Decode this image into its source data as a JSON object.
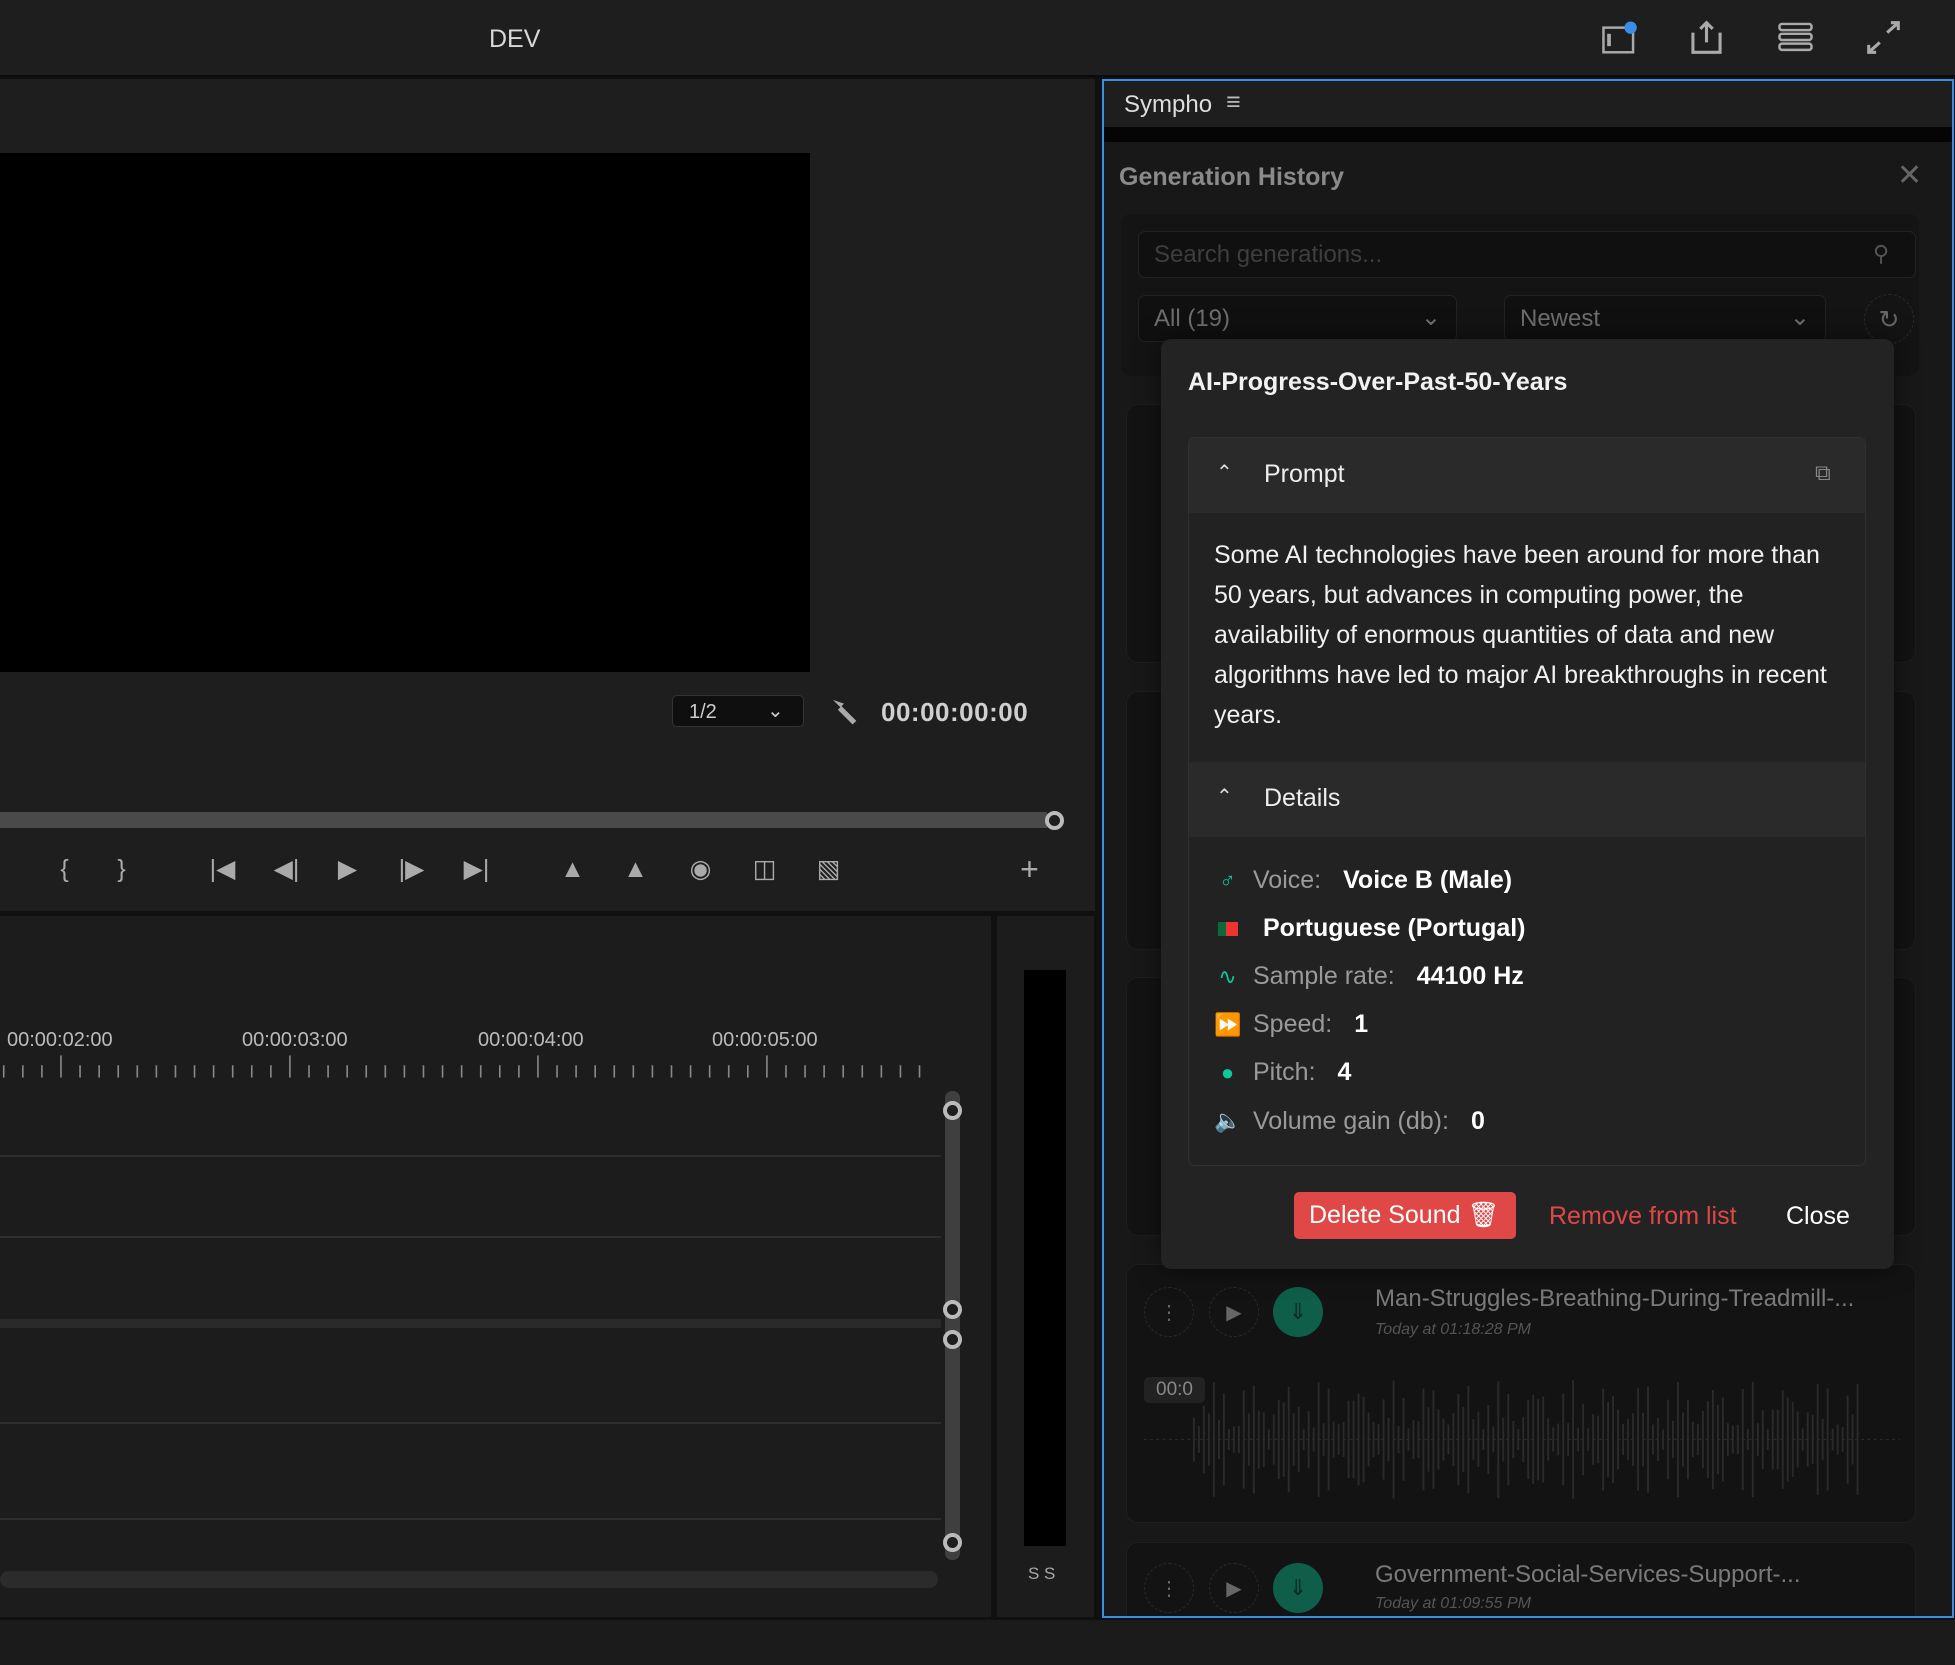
{
  "app": {
    "title": "DEV",
    "top_icons": [
      "panel-notification-icon",
      "share-icon",
      "menu-lines-icon",
      "fullscreen-icon"
    ]
  },
  "monitor": {
    "resolution": "1/2",
    "timecode": "00:00:00:00",
    "controls": [
      "mark-in-icon",
      "mark-out-icon",
      "go-to-in-icon",
      "step-back-icon",
      "play-icon",
      "step-forward-icon",
      "go-to-out-icon",
      "insert-icon",
      "overwrite-icon",
      "camera-icon",
      "compare-icon",
      "toggle-icon",
      "add-icon"
    ]
  },
  "timeline": {
    "ruler": [
      "00:00:02:00",
      "00:00:03:00",
      "00:00:04:00",
      "00:00:05:00"
    ],
    "meter_labels": "S S"
  },
  "panel": {
    "name": "Sympho",
    "history_title": "Generation History",
    "search_placeholder": "Search generations...",
    "filter": "All (19)",
    "sort": "Newest",
    "items": [
      {
        "title": "Man-Struggles-Breathing-During-Treadmill-...",
        "date": "Today at 01:18:28 PM",
        "time": "00:0"
      },
      {
        "title": "Government-Social-Services-Support-...",
        "date": "Today at 01:09:55 PM"
      }
    ]
  },
  "modal": {
    "title": "AI-Progress-Over-Past-50-Years",
    "prompt_label": "Prompt",
    "prompt_text": "Some AI technologies have been around for more than 50 years, but advances in computing power, the availability of enormous quantities of data and new algorithms have led to major AI breakthroughs in recent years.",
    "details_label": "Details",
    "details": [
      {
        "icon": "male-icon",
        "label": "Voice:",
        "value": "Voice B (Male)"
      },
      {
        "icon": "flag-portugal-icon",
        "label": "",
        "value": "Portuguese (Portugal)"
      },
      {
        "icon": "pulse-icon",
        "label": "Sample rate:",
        "value": "44100 Hz"
      },
      {
        "icon": "fast-forward-icon",
        "label": "Speed:",
        "value": "1"
      },
      {
        "icon": "speaking-head-icon",
        "label": "Pitch:",
        "value": "4"
      },
      {
        "icon": "volume-icon",
        "label": "Volume gain (db):",
        "value": "0"
      }
    ],
    "delete_label": "Delete Sound",
    "remove_label": "Remove from list",
    "close_label": "Close"
  },
  "colors": {
    "accent": "#10c79a",
    "danger": "#e04848",
    "focus": "#3b8ee8"
  }
}
